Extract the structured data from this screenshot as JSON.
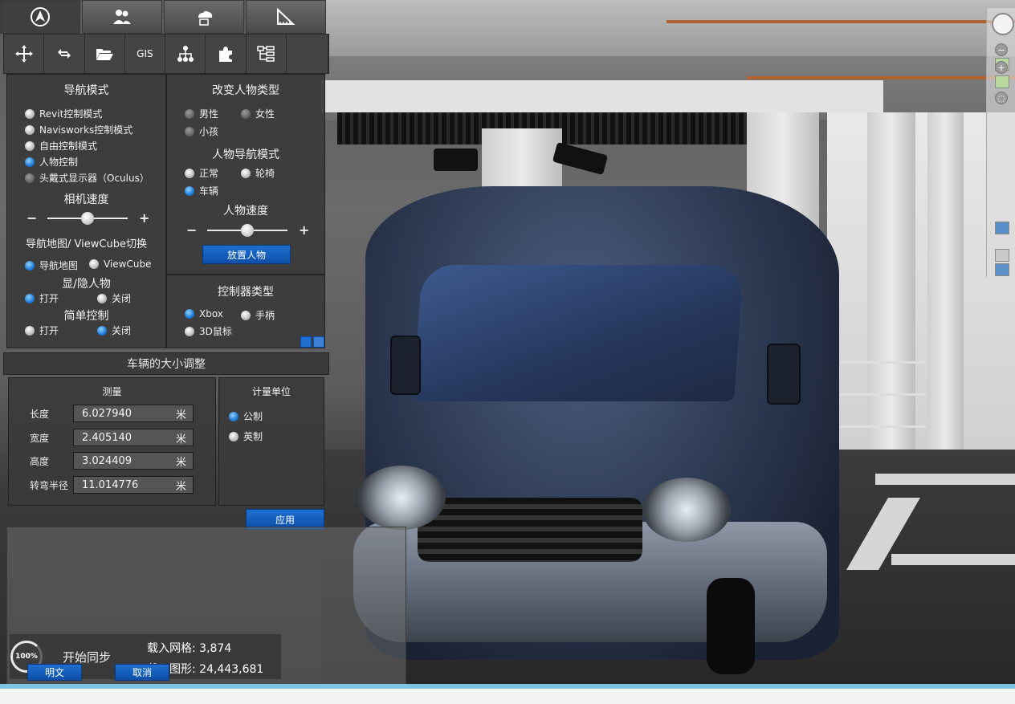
{
  "top_tabs": [
    {
      "name": "navigation",
      "icon": "compass-arrow-icon"
    },
    {
      "name": "collaboration",
      "icon": "users-icon"
    },
    {
      "name": "cloud",
      "icon": "cloud-icon"
    },
    {
      "name": "measure",
      "icon": "ruler-icon"
    }
  ],
  "toolbar": {
    "gis_label": "GIS",
    "tools": [
      "move-icon",
      "swap-icon",
      "folder-icon",
      "gis",
      "hierarchy-icon",
      "puzzle-icon",
      "tree-icon"
    ]
  },
  "nav_panel": {
    "title": "导航模式",
    "modes": [
      {
        "label": "Revit控制模式",
        "selected": false
      },
      {
        "label": "Navisworks控制模式",
        "selected": false
      },
      {
        "label": "自由控制模式",
        "selected": false
      },
      {
        "label": "人物控制",
        "selected": true
      },
      {
        "label": "头戴式显示器（Oculus）",
        "selected": false
      }
    ],
    "camera_speed_title": "相机速度",
    "camera_speed_value": 0.5,
    "map_toggle_title": "导航地图/ ViewCube切换",
    "map_options": [
      {
        "label": "导航地图",
        "selected": true
      },
      {
        "label": "ViewCube",
        "selected": false
      }
    ],
    "show_hide_title": "显/隐人物",
    "show_hide_options": [
      {
        "label": "打开",
        "selected": true
      },
      {
        "label": "关闭",
        "selected": false
      }
    ],
    "simple_title": "简单控制",
    "simple_options": [
      {
        "label": "打开",
        "selected": false
      },
      {
        "label": "关闭",
        "selected": true
      }
    ]
  },
  "person_panel": {
    "title": "改变人物类型",
    "types": [
      {
        "label": "男性",
        "selected": false
      },
      {
        "label": "女性",
        "selected": false
      },
      {
        "label": "小孩",
        "selected": false
      }
    ],
    "nav_mode_title": "人物导航模式",
    "nav_modes": [
      {
        "label": "正常",
        "selected": false
      },
      {
        "label": "轮椅",
        "selected": false
      },
      {
        "label": "车辆",
        "selected": true
      }
    ],
    "speed_title": "人物速度",
    "speed_value": 0.5,
    "place_button": "放置人物"
  },
  "controller_panel": {
    "title": "控制器类型",
    "options": [
      {
        "label": "Xbox",
        "selected": true
      },
      {
        "label": "手柄",
        "selected": false
      },
      {
        "label": "3D鼠标",
        "selected": false
      }
    ]
  },
  "vehicle_panel": {
    "title": "车辆的大小调整",
    "measure_title": "测量",
    "fields": [
      {
        "label": "长度",
        "value": "6.027940",
        "unit": "米"
      },
      {
        "label": "宽度",
        "value": "2.405140",
        "unit": "米"
      },
      {
        "label": "高度",
        "value": "3.024409",
        "unit": "米"
      },
      {
        "label": "转弯半径",
        "value": "11.014776",
        "unit": "米"
      }
    ],
    "unit_title": "计量单位",
    "units": [
      {
        "label": "公制",
        "selected": true
      },
      {
        "label": "英制",
        "selected": false
      }
    ],
    "apply_button": "应用"
  },
  "status": {
    "progress": "100%",
    "sync_label": "开始同步",
    "mesh_loaded": "载入网格: 3,874",
    "shapes_loaded": "载入图形: 24,443,681",
    "plain_button": "明文",
    "cancel_button": "取消"
  },
  "colors": {
    "accent_blue": "#1e6fd0",
    "panel_bg": "#3a3a3a",
    "van_body": "#2f3c55"
  }
}
